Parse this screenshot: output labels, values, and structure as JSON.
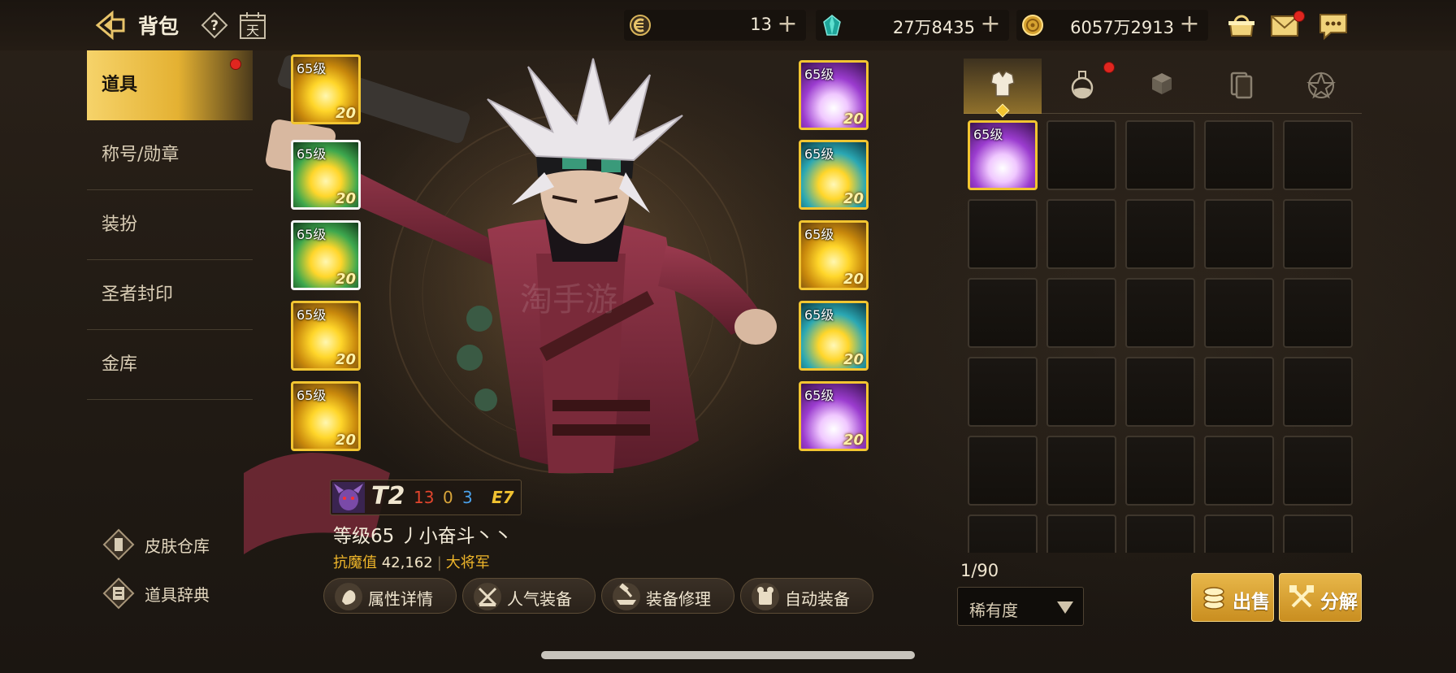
{
  "header": {
    "title": "背包",
    "calendar_glyph": "天",
    "currencies": [
      {
        "name": "fatigue",
        "value": "13",
        "plus": "+"
      },
      {
        "name": "crystal",
        "value": "27万8435",
        "plus": "+"
      },
      {
        "name": "gold",
        "value": "6057万2913",
        "plus": "+"
      }
    ]
  },
  "sidebar": {
    "items": [
      {
        "label": "道具",
        "active": true
      },
      {
        "label": "称号/勋章"
      },
      {
        "label": "装扮"
      },
      {
        "label": "圣者封印"
      },
      {
        "label": "金库"
      }
    ],
    "links": [
      {
        "label": "皮肤仓库"
      },
      {
        "label": "道具辞典"
      }
    ]
  },
  "equipment": {
    "left": [
      {
        "level": "65级",
        "enhance": "20",
        "rarity": "legendary"
      },
      {
        "level": "65级",
        "enhance": "20",
        "rarity": "set"
      },
      {
        "level": "65级",
        "enhance": "20",
        "rarity": "set"
      },
      {
        "level": "65级",
        "enhance": "20",
        "rarity": "legendary"
      },
      {
        "level": "65级",
        "enhance": "20",
        "rarity": "legendary"
      }
    ],
    "right": [
      {
        "level": "65级",
        "enhance": "20",
        "rarity": "epic"
      },
      {
        "level": "65级",
        "enhance": "20",
        "rarity": "cyan"
      },
      {
        "level": "65级",
        "enhance": "20",
        "rarity": "legendary"
      },
      {
        "level": "65级",
        "enhance": "20",
        "rarity": "cyan"
      },
      {
        "level": "65级",
        "enhance": "20",
        "rarity": "epic"
      }
    ]
  },
  "character": {
    "tier": "T2",
    "stat_red": "13",
    "stat_orange": "0",
    "stat_blue": "3",
    "stat_e": "E7",
    "name_line": "等级65 丿小奋斗丶丶",
    "power_label": "抗魔值",
    "power_value": "42,162",
    "title": "大将军"
  },
  "actions": [
    {
      "label": "属性详情"
    },
    {
      "label": "人气装备"
    },
    {
      "label": "装备修理"
    },
    {
      "label": "自动装备"
    }
  ],
  "inventory": {
    "tabs": [
      {
        "icon": "armor-icon",
        "active": true
      },
      {
        "icon": "potion-icon",
        "badge": true
      },
      {
        "icon": "material-cubes-icon"
      },
      {
        "icon": "cards-icon"
      },
      {
        "icon": "pentagram-icon"
      }
    ],
    "items": [
      {
        "level": "65级",
        "rarity": "epic"
      }
    ],
    "count": "1/90",
    "sort_label": "稀有度",
    "sell_label": "出售",
    "dismantle_label": "分解"
  },
  "colors": {
    "accent_gold": "#f2c531",
    "badge_red": "#e0261f"
  }
}
